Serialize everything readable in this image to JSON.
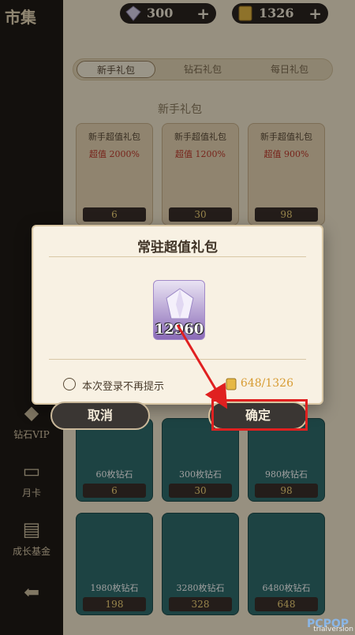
{
  "sidebar": {
    "title": "市集",
    "items": [
      {
        "label": "钻石VIP",
        "icon": "diamond-icon"
      },
      {
        "label": "月卡",
        "icon": "card-icon"
      },
      {
        "label": "成长基金",
        "icon": "growth-fund-icon"
      },
      {
        "label": "",
        "icon": "back-arrow-icon"
      }
    ]
  },
  "topbar": {
    "diamonds": "300",
    "gold": "1326",
    "plus": "+"
  },
  "tabs": [
    "新手礼包",
    "钻石礼包",
    "每日礼包"
  ],
  "section_title": "新手礼包",
  "cards_top": [
    {
      "title": "新手超值礼包",
      "badge": "超值 2000%",
      "price": "6"
    },
    {
      "title": "新手超值礼包",
      "badge": "超值 1200%",
      "price": "30"
    },
    {
      "title": "新手超值礼包",
      "badge": "超值 900%",
      "price": "98"
    }
  ],
  "cards_mid": [
    {
      "caption": "60枚钻石",
      "price": "6"
    },
    {
      "caption": "300枚钻石",
      "price": "30"
    },
    {
      "caption": "980枚钻石",
      "price": "98"
    }
  ],
  "cards_bottom": [
    {
      "caption": "1980枚钻石",
      "price": "198"
    },
    {
      "caption": "3280枚钻石",
      "price": "328"
    },
    {
      "caption": "6480枚钻石",
      "price": "648"
    }
  ],
  "dialog": {
    "title": "常驻超值礼包",
    "item_qty": "12960",
    "checkbox_label": "本次登录不再提示",
    "cost": "648/1326",
    "cancel_label": "取消",
    "confirm_label": "确定"
  },
  "watermark": "PCPOP",
  "trial": "trialversion",
  "colors": {
    "highlight": "#e02020",
    "gold_text": "#d79b31",
    "dialog_bg": "#f8f1e3",
    "button_bg": "#3a3633"
  }
}
